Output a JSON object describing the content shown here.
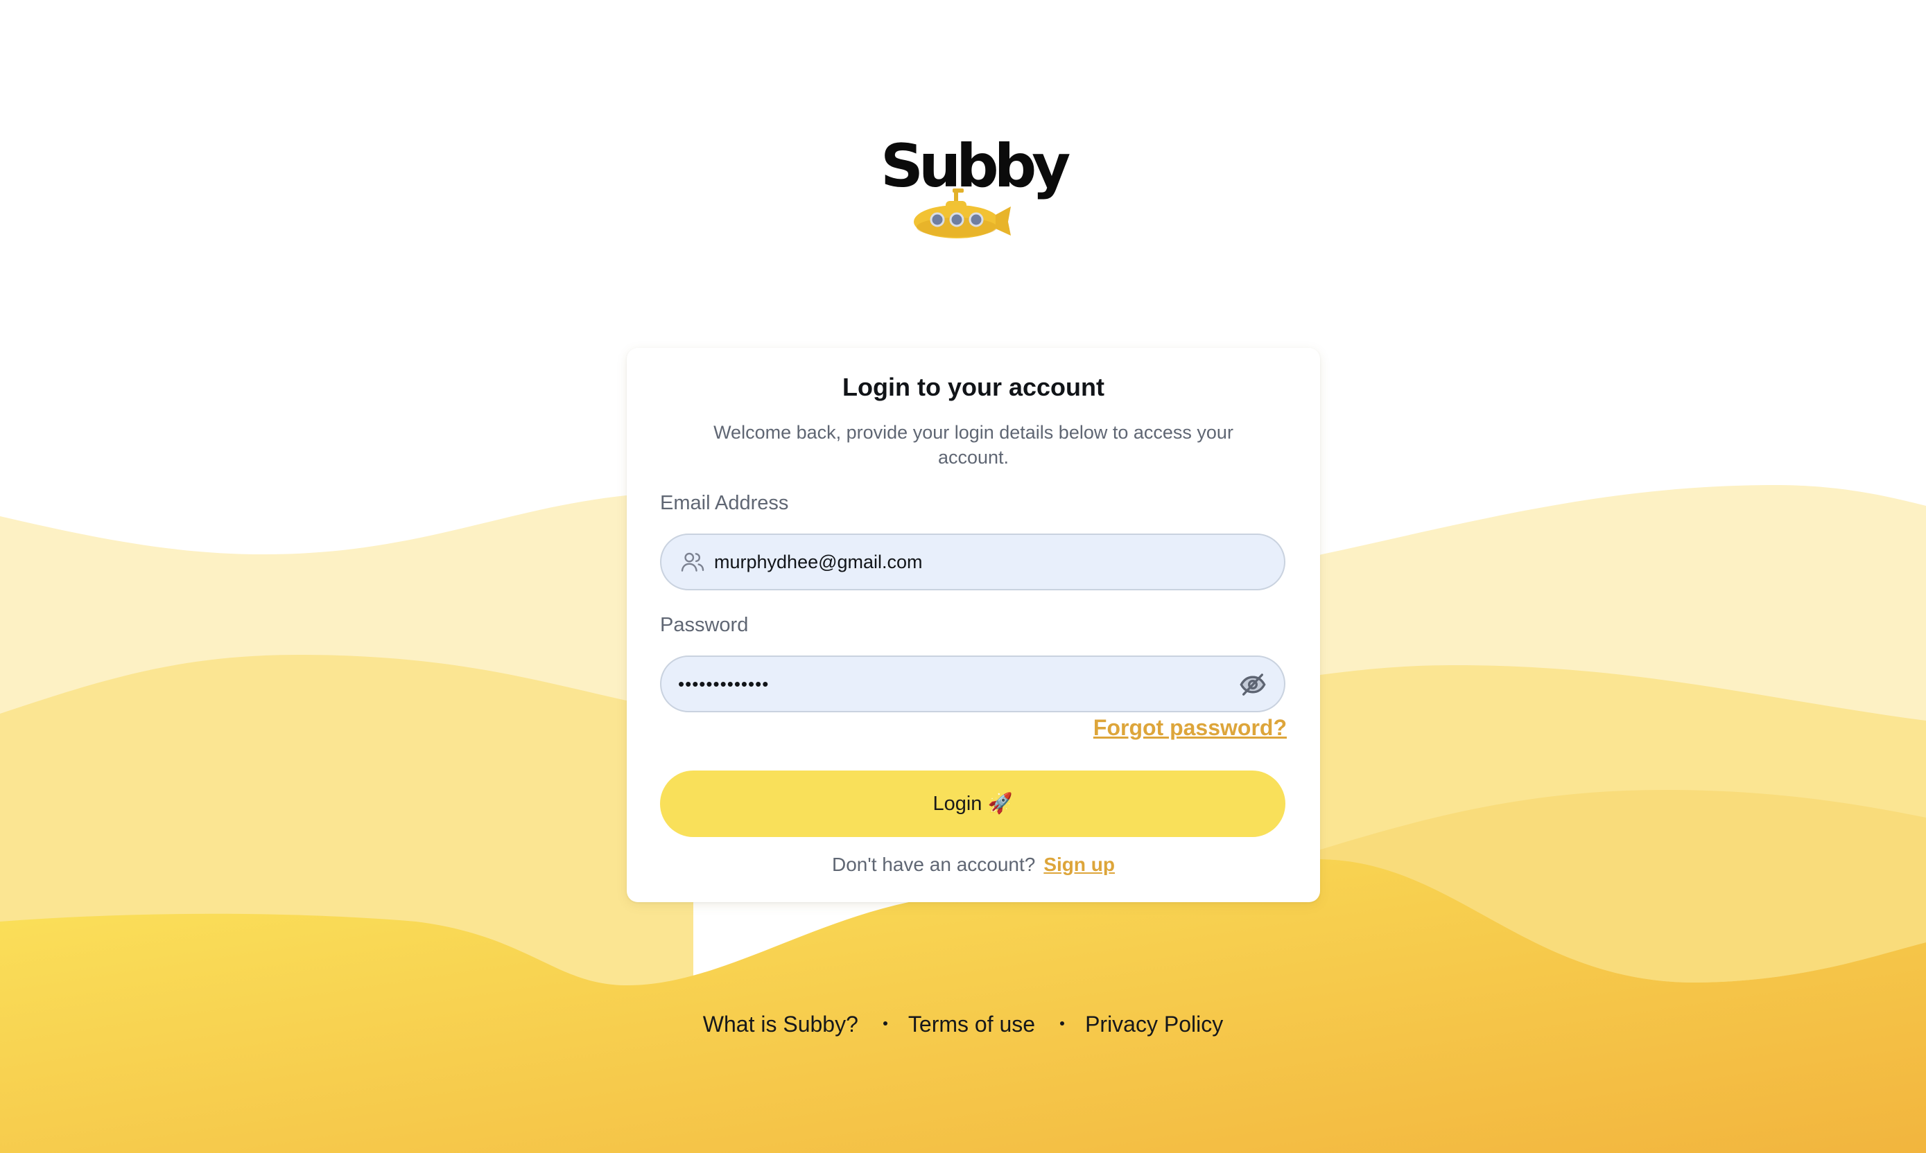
{
  "brand": {
    "name": "Subby",
    "mascot_icon": "yellow-submarine-icon"
  },
  "card": {
    "title": "Login to your account",
    "subtitle": "Welcome back, provide your login details below to access your account.",
    "email": {
      "label": "Email Address",
      "value": "murphydhee@gmail.com",
      "icon": "users-icon"
    },
    "password": {
      "label": "Password",
      "value": "•••••••••••••",
      "icon": "eye-off-icon"
    },
    "forgot_label": "Forgot password?",
    "login_label": "Login 🚀",
    "signup_prompt": "Don't have an account?",
    "signup_label": "Sign up"
  },
  "footer": {
    "links": [
      "What is Subby?",
      "Terms of use",
      "Privacy Policy"
    ]
  },
  "colors": {
    "accent": "#f9e05a",
    "link": "#dda53a",
    "input_bg": "#e8effb",
    "wave_light": "#fdf0c0",
    "wave_mid": "#fae38c",
    "wave_deep": "#f4c04a"
  }
}
